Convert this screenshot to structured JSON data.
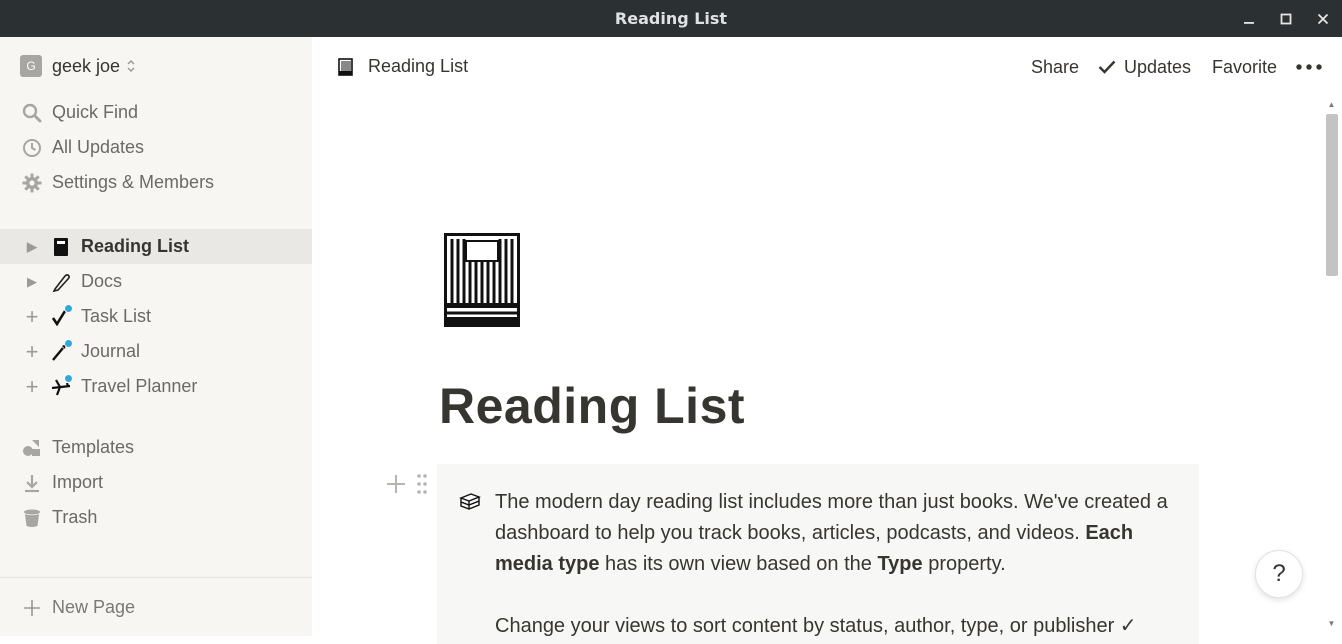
{
  "window": {
    "title": "Reading List"
  },
  "sidebar": {
    "workspace": {
      "initial": "G",
      "name": "geek joe"
    },
    "nav": [
      {
        "label": "Quick Find",
        "icon": "search-icon"
      },
      {
        "label": "All Updates",
        "icon": "clock-icon"
      },
      {
        "label": "Settings & Members",
        "icon": "gear-icon"
      }
    ],
    "pages": [
      {
        "label": "Reading List",
        "toggle": "▶",
        "icon": "book-icon",
        "active": true
      },
      {
        "label": "Docs",
        "toggle": "▶",
        "icon": "pen-icon"
      },
      {
        "label": "Task List",
        "toggle": "+",
        "icon": "checkmark-icon"
      },
      {
        "label": "Journal",
        "toggle": "+",
        "icon": "pen-nib-icon"
      },
      {
        "label": "Travel Planner",
        "toggle": "+",
        "icon": "airplane-icon"
      }
    ],
    "tools": [
      {
        "label": "Templates",
        "icon": "shapes-icon"
      },
      {
        "label": "Import",
        "icon": "download-icon"
      },
      {
        "label": "Trash",
        "icon": "trash-icon"
      }
    ],
    "new_page": "New Page"
  },
  "topbar": {
    "breadcrumb": "Reading List",
    "share": "Share",
    "updates": "Updates",
    "favorite": "Favorite"
  },
  "page": {
    "title": "Reading List",
    "callout": {
      "line1_a": "The modern day reading list includes more than just books. We've created a dashboard to help you track books, articles, podcasts, and videos. ",
      "bold1": "Each media type",
      "line1_b": " has its own view based on the ",
      "bold2": "Type",
      "line1_c": " property.",
      "line2": "Change your views to sort content by status, author, type, or publisher ✓"
    }
  },
  "help": {
    "label": "?"
  },
  "colors": {
    "titlebar": "#2b3032",
    "sidebar": "#f7f6f3",
    "active_item": "#e9e8e5",
    "accent_dot": "#2fa8e0",
    "text": "#37352f"
  }
}
